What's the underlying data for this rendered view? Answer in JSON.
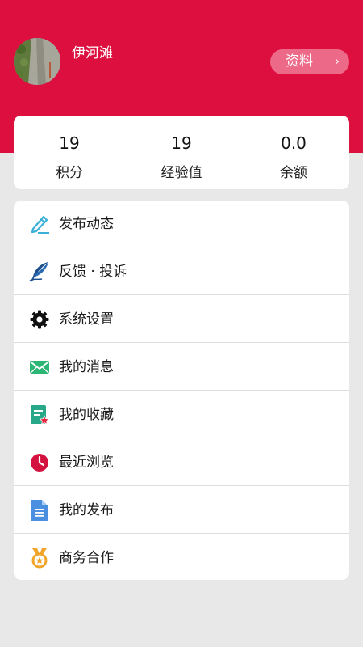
{
  "colors": {
    "header_bg": "#dc0f3e",
    "page_bg": "#e8e8e8",
    "button_bg": "#ec6a88"
  },
  "profile": {
    "username": "伊河滩",
    "profile_button_label": "资料",
    "chevron": "›"
  },
  "stats": [
    {
      "value": "19",
      "label": "积分"
    },
    {
      "value": "19",
      "label": "经验值"
    },
    {
      "value": "0.0",
      "label": "余额"
    }
  ],
  "menu": [
    {
      "label": "发布动态",
      "icon": "pen-write-icon"
    },
    {
      "label": "反馈 · 投诉",
      "icon": "quill-feather-icon"
    },
    {
      "label": "系统设置",
      "icon": "gear-icon"
    },
    {
      "label": "我的消息",
      "icon": "envelope-icon"
    },
    {
      "label": "我的收藏",
      "icon": "bookmark-star-icon"
    },
    {
      "label": "最近浏览",
      "icon": "clock-icon"
    },
    {
      "label": "我的发布",
      "icon": "document-icon"
    },
    {
      "label": "商务合作",
      "icon": "medal-icon"
    }
  ]
}
